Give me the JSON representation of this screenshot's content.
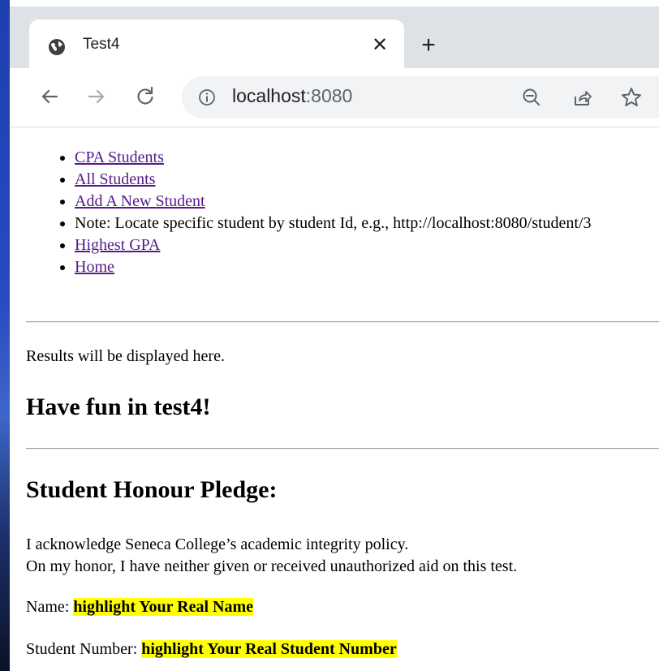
{
  "browser": {
    "tab_title": "Test4",
    "url_host": "localhost",
    "url_port": ":8080"
  },
  "nav": {
    "items": [
      {
        "label": "CPA Students",
        "type": "link"
      },
      {
        "label": "All Students",
        "type": "link"
      },
      {
        "label": "Add A New Student",
        "type": "link"
      },
      {
        "label": "Note: Locate specific student by student Id, e.g., http://localhost:8080/student/3",
        "type": "text"
      },
      {
        "label": "Highest GPA",
        "type": "link"
      },
      {
        "label": "Home",
        "type": "link"
      }
    ]
  },
  "main": {
    "results_text": "Results will be displayed here.",
    "fun_heading": "Have fun in test4!",
    "pledge_heading": "Student Honour Pledge:",
    "pledge_line1": "I acknowledge Seneca College’s academic integrity policy.",
    "pledge_line2": "On my honor, I have neither given or received unauthorized aid on this test.",
    "name_label": "Name:",
    "name_value": "highlight Your Real Name",
    "number_label": "Student Number:",
    "number_value": "highlight Your Real Student Number"
  },
  "icons": {
    "tab": "globe-icon",
    "close": "close-icon",
    "new_tab": "plus-icon",
    "back": "arrow-left-icon",
    "forward": "arrow-right-icon",
    "reload": "reload-icon",
    "site_info": "info-icon",
    "zoom": "zoom-out-icon",
    "share": "share-icon",
    "bookmark": "star-icon"
  },
  "colors": {
    "link": "#551a8b",
    "highlight": "#ffff00",
    "chrome_bg": "#dee1e6",
    "omnibox_bg": "#f1f3f4"
  }
}
